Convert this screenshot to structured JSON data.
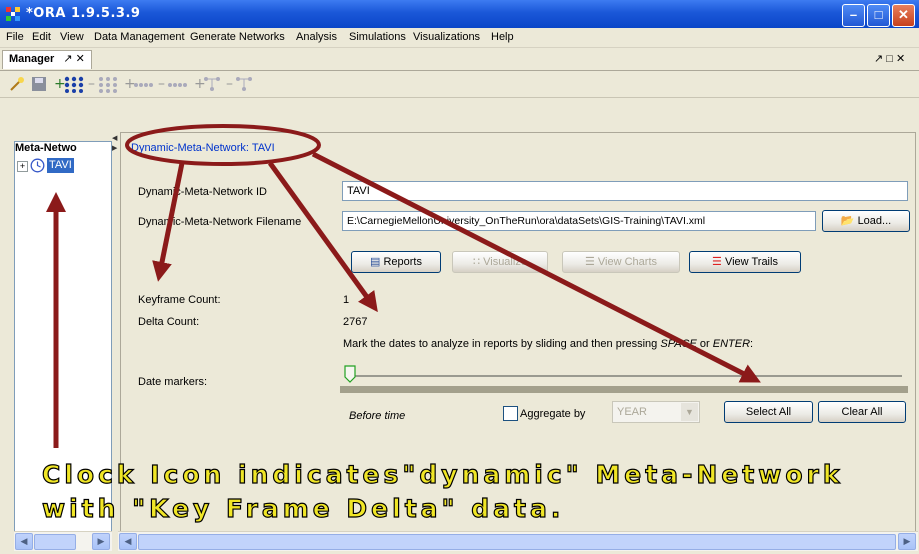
{
  "window": {
    "title": "*ORA 1.9.5.3.9"
  },
  "menu": [
    "File",
    "Edit",
    "View",
    "Data Management",
    "Generate Networks",
    "Analysis",
    "Simulations",
    "Visualizations",
    "Help"
  ],
  "manager": {
    "tab_label": "Manager",
    "tab_controls": "↗ ✕",
    "right_controls": "↗ □ ✕"
  },
  "tree": {
    "header": "Meta-Netwo",
    "node_label": "TAVI"
  },
  "panel": {
    "header_link": "Dynamic-Meta-Network: TAVI",
    "id_label": "Dynamic-Meta-Network ID",
    "id_value": "TAVI",
    "filename_label": "Dynamic-Meta-Network Filename",
    "filename_value": "E:\\CarnegieMellonUniversity_OnTheRun\\ora\\dataSets\\GIS-Training\\TAVI.xml",
    "load_button": "Load...",
    "reports_button": "Reports",
    "visualize_button": "Visualize",
    "view_charts_button": "View Charts",
    "view_trails_button": "View Trails",
    "keyframe_label": "Keyframe Count:",
    "keyframe_value": "1",
    "delta_label": "Delta Count:",
    "delta_value": "2767",
    "instruction_prefix": "Mark the dates to analyze in reports by sliding and then pressing ",
    "instruction_key1": "SPACE",
    "instruction_or": " or ",
    "instruction_key2": "ENTER",
    "instruction_suffix": ":",
    "date_markers_label": "Date markers:",
    "before_time": "Before time",
    "aggregate_label": "Aggregate by",
    "aggregate_value": "YEAR",
    "select_all_button": "Select All",
    "clear_all_button": "Clear All"
  },
  "annotation": {
    "line1": "Clock Icon indicates\"dynamic\" Meta-Network",
    "line2": "with \"Key Frame Delta\" data."
  },
  "colors": {
    "title_bar": "#1a57d8",
    "selection": "#316ac5",
    "annotation_text": "#f0e626",
    "arrow": "#8b1a1a",
    "link": "#0033cc"
  }
}
